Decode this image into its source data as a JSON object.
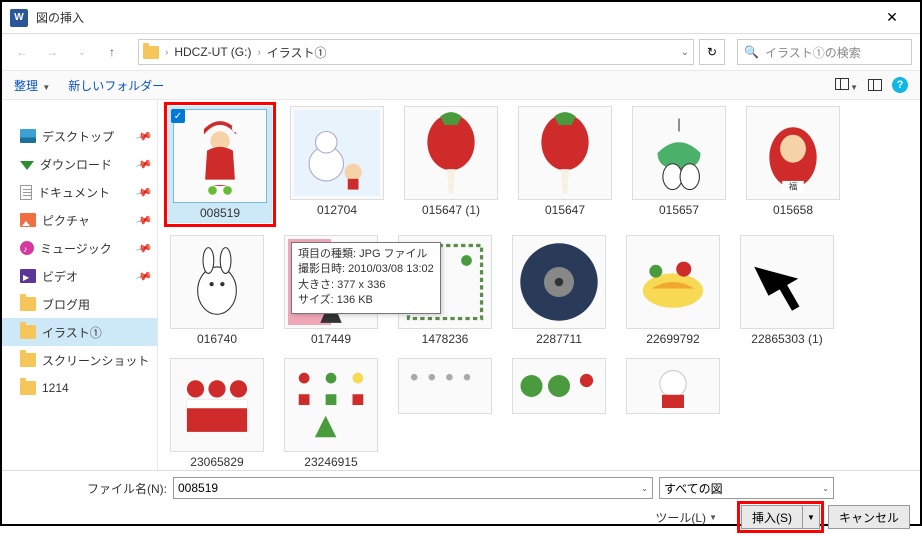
{
  "titlebar": {
    "title": "図の挿入"
  },
  "breadcrumb": {
    "drive": "HDCZ-UT (G:)",
    "folder": "イラスト①"
  },
  "search": {
    "placeholder": "イラスト①の検索"
  },
  "toolbar": {
    "organize": "整理",
    "newfolder": "新しいフォルダー"
  },
  "sidebar": {
    "items": [
      {
        "label": "デスクトップ",
        "pin": true,
        "icon": "desktop"
      },
      {
        "label": "ダウンロード",
        "pin": true,
        "icon": "download"
      },
      {
        "label": "ドキュメント",
        "pin": true,
        "icon": "doc"
      },
      {
        "label": "ピクチャ",
        "pin": true,
        "icon": "pic"
      },
      {
        "label": "ミュージック",
        "pin": true,
        "icon": "music"
      },
      {
        "label": "ビデオ",
        "pin": true,
        "icon": "video"
      },
      {
        "label": "ブログ用",
        "pin": false,
        "icon": "folder"
      },
      {
        "label": "イラスト①",
        "pin": false,
        "icon": "folder",
        "selected": true
      },
      {
        "label": "スクリーンショット",
        "pin": false,
        "icon": "folder"
      },
      {
        "label": "1214",
        "pin": false,
        "icon": "folder"
      }
    ]
  },
  "files": {
    "row1": [
      {
        "name": "008519",
        "selected": true,
        "highlight": true
      },
      {
        "name": "012704"
      },
      {
        "name": "015647 (1)"
      },
      {
        "name": "015647"
      },
      {
        "name": "015657"
      },
      {
        "name": "015658"
      },
      {
        "name": "016740"
      }
    ],
    "row2": [
      {
        "name": "017449"
      },
      {
        "name": "1478236"
      },
      {
        "name": "2287711"
      },
      {
        "name": "22699792"
      },
      {
        "name": "22865303 (1)"
      },
      {
        "name": "23065829"
      },
      {
        "name": "23246915"
      }
    ],
    "row3": [
      {
        "name": ""
      },
      {
        "name": ""
      },
      {
        "name": ""
      }
    ]
  },
  "tooltip": {
    "line1": "項目の種類: JPG ファイル",
    "line2": "撮影日時: 2010/03/08 13:02",
    "line3": "大きさ: 377 x 336",
    "line4": "サイズ: 136 KB"
  },
  "footer": {
    "filename_label": "ファイル名(N):",
    "filename_value": "008519",
    "filter_value": "すべての図",
    "tools": "ツール(L)",
    "insert": "挿入(S)",
    "cancel": "キャンセル"
  }
}
